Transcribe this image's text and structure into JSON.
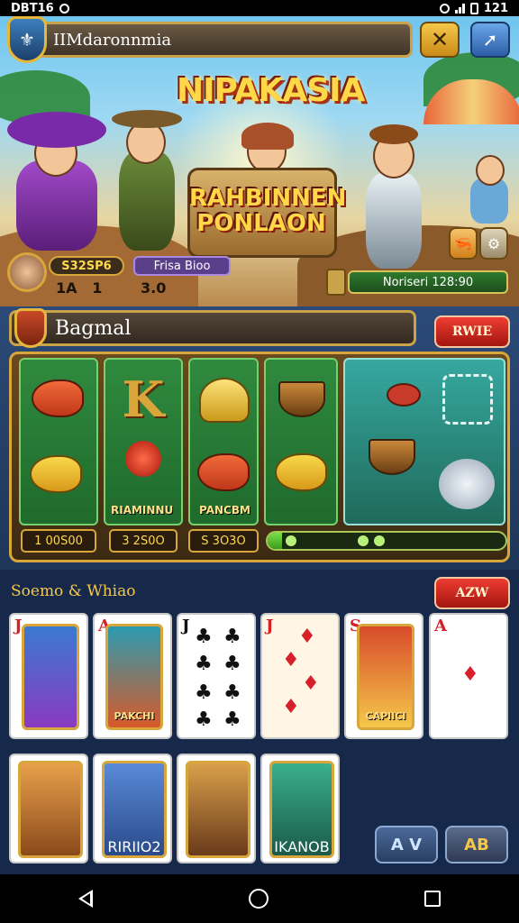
{
  "status_bar": {
    "time_left": "DBT16",
    "time_right": "121"
  },
  "header": {
    "title": "IIMdaronnmia",
    "close_icon": "close-icon",
    "share_icon": "share-icon"
  },
  "hero": {
    "title": "NIPAKASIA",
    "subtitle": "RAHBINNEN PONLAON",
    "coins": "S32SP6",
    "gems": "Frisa Bioo",
    "stat_a": "1A   1",
    "stat_b": "3.0",
    "timer": "Noriseri 128:90"
  },
  "reels": {
    "title": "Bagmal",
    "action_label": "RWIE",
    "symbol_labels": [
      "RIAMINNU",
      "PANCBM"
    ],
    "values": [
      "1 00S00",
      "3 2S0O",
      "S 3O3O"
    ],
    "progress_fraction": 0.06
  },
  "cards": {
    "title": "Soemo & Whiao",
    "action_label": "AZW",
    "row1": [
      {
        "rank": "J",
        "suit": "red",
        "label": ""
      },
      {
        "rank": "A",
        "suit": "red",
        "label": "PAKCHI"
      },
      {
        "rank": "J",
        "suit": "black",
        "label": ""
      },
      {
        "rank": "J",
        "suit": "red",
        "label": ""
      },
      {
        "rank": "S",
        "suit": "red",
        "label": "CAPIICI"
      },
      {
        "rank": "A",
        "suit": "red",
        "label": ""
      }
    ],
    "row2_labels": [
      "",
      "RIRIIO2",
      "",
      "IKANOB"
    ],
    "btn_left": "A V",
    "btn_right": "AB"
  },
  "colors": {
    "accent_gold": "#d8a63a",
    "button_red": "#ee3d32",
    "reel_green": "#2f8a3e"
  }
}
